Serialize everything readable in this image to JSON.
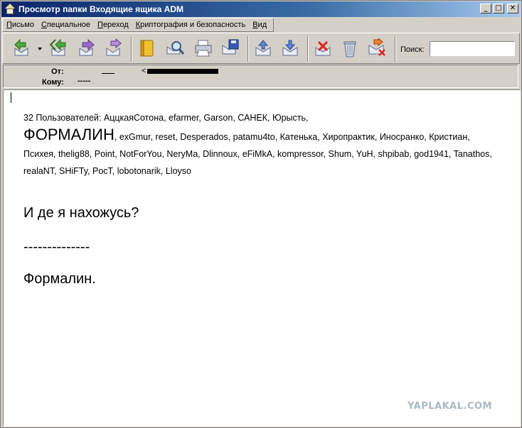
{
  "window": {
    "title": "Просмотр папки Входящие ящика ADM",
    "controls": {
      "minimize": "_",
      "maximize": "□",
      "close": "✕"
    }
  },
  "menu": [
    "Письмо",
    "Специальное",
    "Переход",
    "Криптография и безопасность",
    "Вид"
  ],
  "toolbar": {
    "buttons": [
      "reply-icon",
      "reply-all-icon",
      "forward-icon",
      "redirect-icon",
      "address-book-icon",
      "find-icon",
      "print-icon",
      "save-icon",
      "previous-message-icon",
      "next-message-icon",
      "delete-message-icon",
      "trash-icon",
      "delete-forever-icon"
    ],
    "search_label": "Поиск:",
    "search_value": ""
  },
  "header": {
    "from_label": "От:",
    "from_value": "<",
    "to_label": "Кому:",
    "to_value": "-----"
  },
  "message": {
    "users_prefix": "32 Пользователей: АццкаяСотона, efarmer, Garson, САНЕК, Юрысть,",
    "users_highlight": "ФОРМАЛИН",
    "users_rest": ", exGmur, reset, Desperados, patamu4to, Катенька, Хиропрактик, Иносранко, Кристиан, Психея, thelig88, Point, NotForYou, NeryMa, Dlinnoux, eFiMkA, kompressor, Shum, YuH, shpibab, god1941, Tanathos, realaNT, SHiFTy, PocT, lobotonarik, Lloyso",
    "question": "И де я нахожусь?",
    "dashes": "--------------",
    "signature": "Формалин."
  },
  "watermark": "YAPLAKAL.COM"
}
